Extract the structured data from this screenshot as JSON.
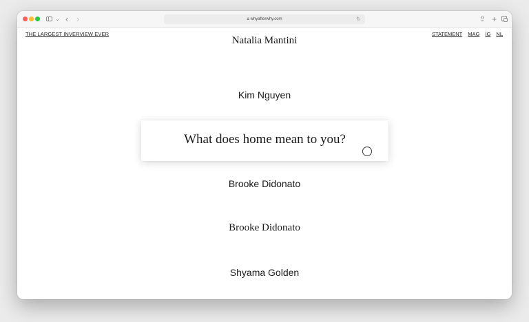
{
  "browser": {
    "url": "whyafterwhy.com"
  },
  "nav": {
    "left_link": "THE LARGEST INVERVIEW EVER",
    "right_links": [
      "STATEMENT",
      "MAG",
      "IG",
      "NL"
    ]
  },
  "names": [
    "Natalia Mantini",
    "Kim Nguyen",
    "Brooke Didonato",
    "Brooke Didonato",
    "Shyama Golden"
  ],
  "question_card": {
    "text": "What does home mean to you?"
  },
  "icons": {
    "lock": "lock-icon",
    "reload": "reload-icon",
    "share": "share-icon",
    "new_tab": "plus-icon",
    "tab_overview": "tabs-icon",
    "sidebar": "sidebar-icon",
    "cursor": "circle-cursor-icon"
  },
  "colors": {
    "window_background": "#ffffff",
    "text": "#1a1a1a",
    "traffic_red": "#ff5f57",
    "traffic_yellow": "#febc2e",
    "traffic_green": "#28c840"
  }
}
